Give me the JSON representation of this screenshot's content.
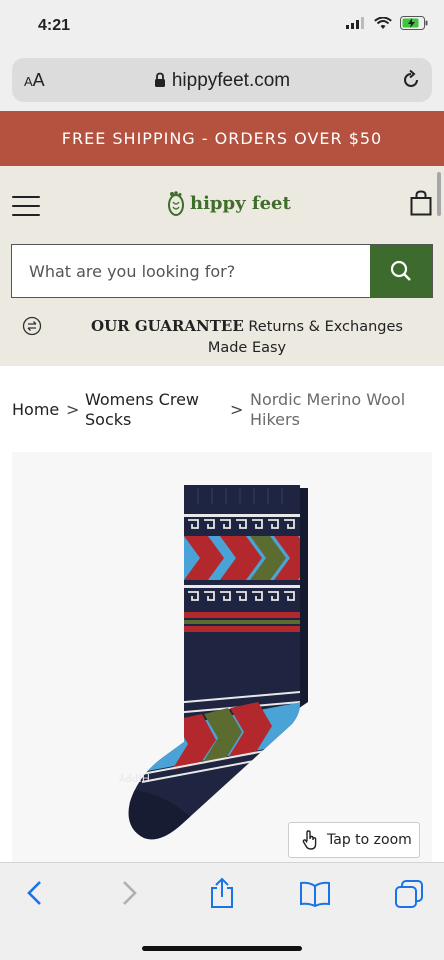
{
  "status": {
    "time": "4:21"
  },
  "browser": {
    "text_size_label_small": "A",
    "text_size_label_large": "A",
    "domain": "hippyfeet.com"
  },
  "promo": {
    "text": "FREE SHIPPING - ORDERS OVER $50"
  },
  "header": {
    "logo_text": "hippy feet",
    "search_placeholder": "What are you looking for?",
    "guarantee_title": "OUR GUARANTEE",
    "guarantee_text": "Returns & Exchanges Made Easy"
  },
  "breadcrumb": {
    "home": "Home",
    "separator": ">",
    "category": "Womens Crew Socks",
    "current": "Nordic Merino Wool Hikers"
  },
  "product": {
    "zoom_label": "Tap to zoom",
    "sock_brand_print": "HIPPY"
  },
  "colors": {
    "promo_bg": "#b4523f",
    "brand_green": "#3d6b2d",
    "header_bg": "#ece9e1",
    "sock_navy": "#1f2440",
    "sock_red": "#b3282c",
    "sock_olive": "#5c6b2f",
    "sock_blue": "#4aa3d6"
  },
  "icons": {
    "menu": "hamburger-icon",
    "cart": "shopping-bag-icon",
    "search": "search-icon",
    "guarantee": "exchange-arrows-icon",
    "zoom": "tap-hand-icon",
    "back": "chevron-left-icon",
    "forward": "chevron-right-icon",
    "share": "share-icon",
    "bookmarks": "book-icon",
    "tabs": "tabs-icon"
  }
}
